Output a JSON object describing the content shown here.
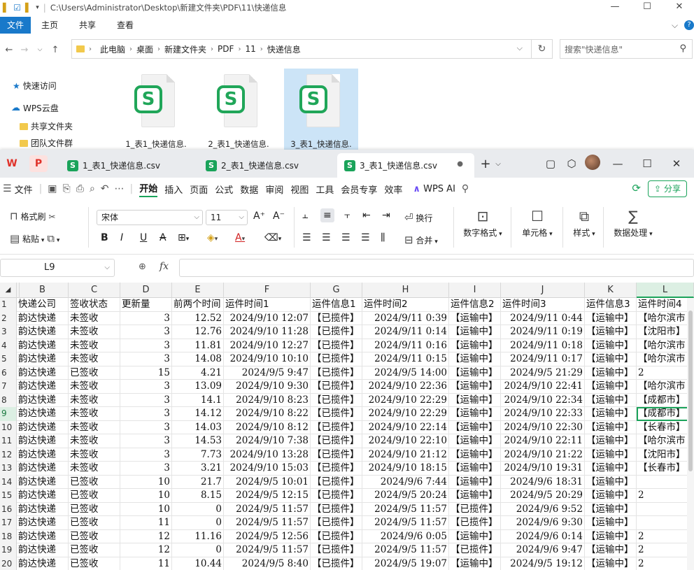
{
  "explorer": {
    "title_path": "C:\\Users\\Administrator\\Desktop\\新建文件夹\\PDF\\11\\快递信息",
    "ribbon_tabs": [
      "文件",
      "主页",
      "共享",
      "查看"
    ],
    "breadcrumb": [
      "此电脑",
      "桌面",
      "新建文件夹",
      "PDF",
      "11",
      "快递信息"
    ],
    "search_placeholder": "搜索\"快递信息\"",
    "nav": [
      "快速访问",
      "WPS云盘",
      "共享文件夹",
      "团队文件群"
    ],
    "files": [
      "1_表1_快递信息.",
      "2_表1_快递信息.",
      "3_表1_快递信息."
    ]
  },
  "wps": {
    "tabs": [
      "1_表1_快递信息.csv",
      "2_表1_快递信息.csv",
      "3_表1_快递信息.csv"
    ],
    "menu": [
      "文件",
      "开始",
      "插入",
      "页面",
      "公式",
      "数据",
      "审阅",
      "视图",
      "工具",
      "会员专享",
      "效率"
    ],
    "wps_ai": "WPS AI",
    "share": "分享",
    "ribbon": {
      "format_painter": "格式刷",
      "paste": "粘贴",
      "font_name": "宋体",
      "font_size": "11",
      "wrap": "换行",
      "merge": "合并",
      "number_format": "数字格式",
      "cell": "单元格",
      "style": "样式",
      "data_process": "数据处理",
      "bold": "B",
      "italic": "I",
      "underline": "U",
      "strike": "A"
    },
    "name_box": "L9",
    "fx": "fx",
    "columns": [
      "B",
      "C",
      "D",
      "E",
      "F",
      "G",
      "H",
      "I",
      "J",
      "K",
      "L"
    ],
    "header_row": [
      "快递公司",
      "签收状态",
      "更新量",
      "前两个时间",
      "运件时间1",
      "运件信息1",
      "运件时间2",
      "运件信息2",
      "运件时间3",
      "运件信息3",
      "运件时间4"
    ],
    "rows": [
      [
        "韵达快递",
        "未签收",
        "3",
        "12.52",
        "2024/9/10 12:07",
        "【已揽件】",
        "2024/9/11 0:39",
        "【运输中】",
        "2024/9/11 0:44",
        "【运输中】",
        "【哈尔滨市"
      ],
      [
        "韵达快递",
        "未签收",
        "3",
        "12.76",
        "2024/9/10 11:28",
        "【已揽件】",
        "2024/9/11 0:14",
        "【运输中】",
        "2024/9/11 0:19",
        "【运输中】",
        "【沈阳市】"
      ],
      [
        "韵达快递",
        "未签收",
        "3",
        "11.81",
        "2024/9/10 12:27",
        "【已揽件】",
        "2024/9/11 0:16",
        "【运输中】",
        "2024/9/11 0:18",
        "【运输中】",
        "【哈尔滨市"
      ],
      [
        "韵达快递",
        "未签收",
        "3",
        "14.08",
        "2024/9/10 10:10",
        "【已揽件】",
        "2024/9/11 0:15",
        "【运输中】",
        "2024/9/11 0:17",
        "【运输中】",
        "【哈尔滨市"
      ],
      [
        "韵达快递",
        "已签收",
        "15",
        "4.21",
        "2024/9/5 9:47",
        "【已揽件】",
        "2024/9/5 14:00",
        "【运输中】",
        "2024/9/5 21:29",
        "【运输中】",
        "2"
      ],
      [
        "韵达快递",
        "未签收",
        "3",
        "13.09",
        "2024/9/10 9:30",
        "【已揽件】",
        "2024/9/10 22:36",
        "【运输中】",
        "2024/9/10 22:41",
        "【运输中】",
        "【哈尔滨市"
      ],
      [
        "韵达快递",
        "未签收",
        "3",
        "14.1",
        "2024/9/10 8:23",
        "【已揽件】",
        "2024/9/10 22:29",
        "【运输中】",
        "2024/9/10 22:34",
        "【运输中】",
        "【成都市】"
      ],
      [
        "韵达快递",
        "未签收",
        "3",
        "14.12",
        "2024/9/10 8:22",
        "【已揽件】",
        "2024/9/10 22:29",
        "【运输中】",
        "2024/9/10 22:33",
        "【运输中】",
        "【成都市】"
      ],
      [
        "韵达快递",
        "未签收",
        "3",
        "14.03",
        "2024/9/10 8:12",
        "【已揽件】",
        "2024/9/10 22:14",
        "【运输中】",
        "2024/9/10 22:30",
        "【运输中】",
        "【长春市】"
      ],
      [
        "韵达快递",
        "未签收",
        "3",
        "14.53",
        "2024/9/10 7:38",
        "【已揽件】",
        "2024/9/10 22:10",
        "【运输中】",
        "2024/9/10 22:11",
        "【运输中】",
        "【哈尔滨市"
      ],
      [
        "韵达快递",
        "未签收",
        "3",
        "7.73",
        "2024/9/10 13:28",
        "【已揽件】",
        "2024/9/10 21:12",
        "【运输中】",
        "2024/9/10 21:22",
        "【运输中】",
        "【沈阳市】"
      ],
      [
        "韵达快递",
        "未签收",
        "3",
        "3.21",
        "2024/9/10 15:03",
        "【已揽件】",
        "2024/9/10 18:15",
        "【运输中】",
        "2024/9/10 19:31",
        "【运输中】",
        "【长春市】"
      ],
      [
        "韵达快递",
        "已签收",
        "10",
        "21.7",
        "2024/9/5 10:01",
        "【已揽件】",
        "2024/9/6 7:44",
        "【运输中】",
        "2024/9/6 18:31",
        "【运输中】",
        ""
      ],
      [
        "韵达快递",
        "已签收",
        "10",
        "8.15",
        "2024/9/5 12:15",
        "【已揽件】",
        "2024/9/5 20:24",
        "【运输中】",
        "2024/9/5 20:29",
        "【运输中】",
        "2"
      ],
      [
        "韵达快递",
        "已签收",
        "10",
        "0",
        "2024/9/5 11:57",
        "【已揽件】",
        "2024/9/5 11:57",
        "【已揽件】",
        "2024/9/6 9:52",
        "【运输中】",
        ""
      ],
      [
        "韵达快递",
        "已签收",
        "11",
        "0",
        "2024/9/5 11:57",
        "【已揽件】",
        "2024/9/5 11:57",
        "【已揽件】",
        "2024/9/6 9:30",
        "【运输中】",
        ""
      ],
      [
        "韵达快递",
        "已签收",
        "12",
        "11.16",
        "2024/9/5 12:56",
        "【已揽件】",
        "2024/9/6 0:05",
        "【运输中】",
        "2024/9/6 0:14",
        "【运输中】",
        "2"
      ],
      [
        "韵达快递",
        "已签收",
        "12",
        "0",
        "2024/9/5 11:57",
        "【已揽件】",
        "2024/9/5 11:57",
        "【已揽件】",
        "2024/9/6 9:47",
        "【运输中】",
        "2"
      ],
      [
        "韵达快递",
        "已签收",
        "11",
        "10.44",
        "2024/9/5 8:40",
        "【已揽件】",
        "2024/9/5 19:07",
        "【运输中】",
        "2024/9/5 19:12",
        "【运输中】",
        "2"
      ]
    ],
    "accent": "#1aa35a"
  }
}
